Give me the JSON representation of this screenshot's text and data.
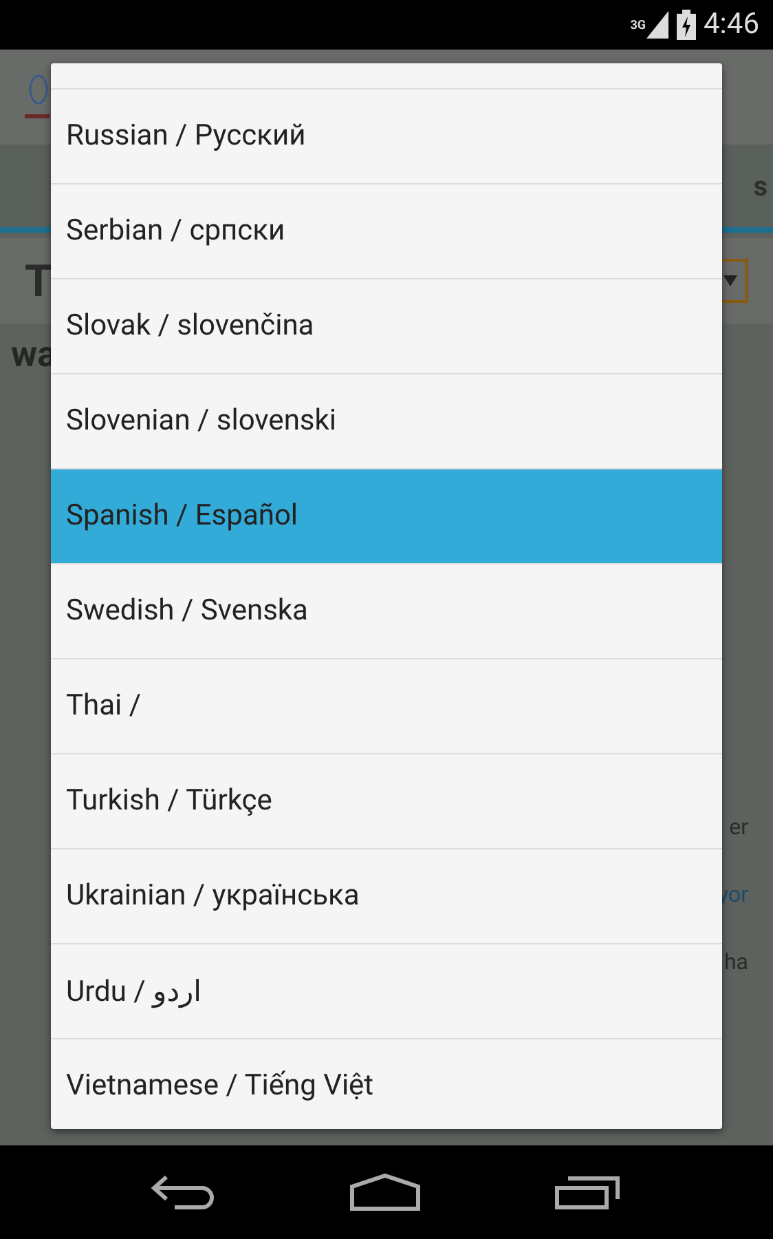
{
  "status_bar": {
    "network": "3G",
    "time": "4:46"
  },
  "background": {
    "tab_fragment": "s",
    "title_fragment": "T",
    "heading_fragment": "wa",
    "text_fragments": [
      {
        "text": "er",
        "kind": "text"
      },
      {
        "text": "yor",
        "kind": "link"
      },
      {
        "text": "ha",
        "kind": "text"
      }
    ]
  },
  "dialog": {
    "items": [
      {
        "label": "Russian / Русский",
        "selected": false
      },
      {
        "label": "Serbian / српски",
        "selected": false
      },
      {
        "label": "Slovak / slovenčina",
        "selected": false
      },
      {
        "label": "Slovenian / slovenski",
        "selected": false
      },
      {
        "label": "Spanish / Español",
        "selected": true
      },
      {
        "label": "Swedish / Svenska",
        "selected": false
      },
      {
        "label": "Thai /",
        "selected": false
      },
      {
        "label": "Turkish / Türkçe",
        "selected": false
      },
      {
        "label": "Ukrainian / українська",
        "selected": false
      },
      {
        "label": "Urdu / اردو",
        "selected": false
      },
      {
        "label": "Vietnamese / Tiếng Việt",
        "selected": false
      }
    ]
  }
}
